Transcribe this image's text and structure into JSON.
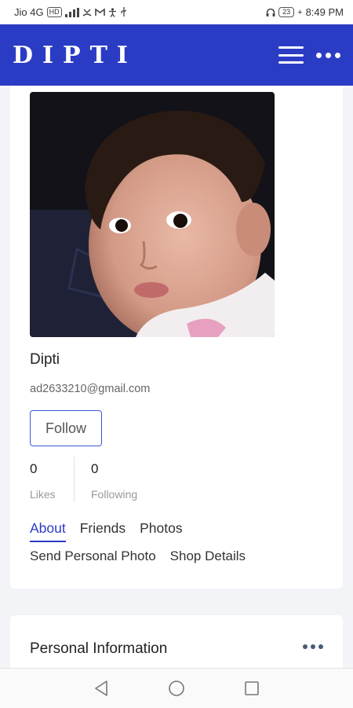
{
  "status_bar": {
    "carrier": "Jio 4G",
    "hd_badge": "HD",
    "battery": "23",
    "time": "8:49 PM"
  },
  "app_bar": {
    "brand": "DIPTI",
    "menu_icon": "hamburger-icon",
    "more_icon": "more-horizontal-icon",
    "color": "#2b3cc4"
  },
  "profile": {
    "name": "Dipti",
    "email": "ad2633210@gmail.com",
    "follow_label": "Follow",
    "stats": [
      {
        "value": "0",
        "label": "Likes"
      },
      {
        "value": "0",
        "label": "Following"
      }
    ]
  },
  "tabs": {
    "row1": [
      "About",
      "Friends",
      "Photos"
    ],
    "row2": [
      "Send Personal Photo",
      "Shop Details"
    ],
    "active": "About"
  },
  "personal_info": {
    "title": "Personal Information",
    "menu_icon": "more-horizontal-icon"
  },
  "nav_bar": {
    "icons": [
      "back-icon",
      "home-icon",
      "recents-icon"
    ]
  }
}
